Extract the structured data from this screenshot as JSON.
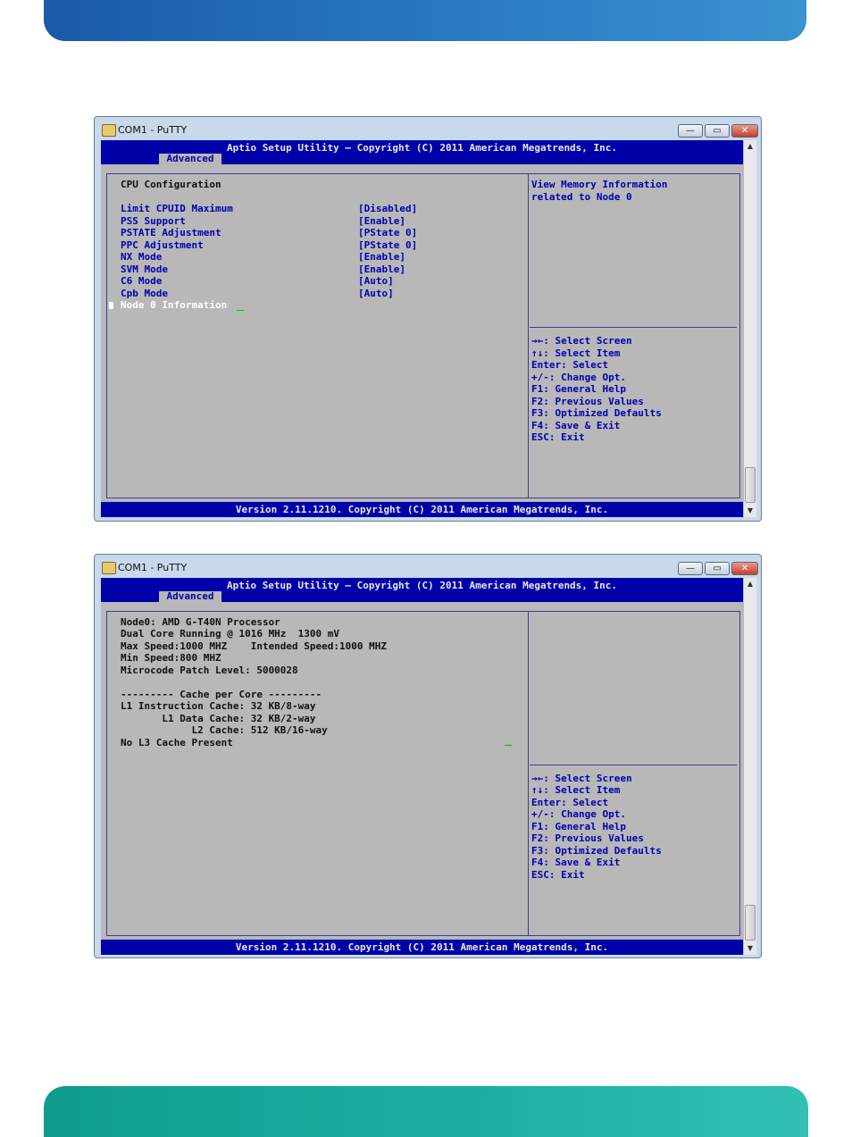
{
  "window1": {
    "title": "COM1 - PuTTY",
    "buttons": {
      "minimize": "—",
      "maximize": "▭",
      "close": "✕"
    },
    "header_title": "Aptio Setup Utility – Copyright (C) 2011 American Megatrends, Inc.",
    "active_tab": "Advanced",
    "section_title": "CPU Configuration",
    "settings": [
      {
        "label": "Limit CPUID Maximum",
        "value": "[Disabled]"
      },
      {
        "label": "PSS Support",
        "value": "[Enable]"
      },
      {
        "label": "PSTATE Adjustment",
        "value": "[PState 0]"
      },
      {
        "label": "PPC Adjustment",
        "value": "[PState 0]"
      },
      {
        "label": "NX Mode",
        "value": "[Enable]"
      },
      {
        "label": "SVM Mode",
        "value": "[Enable]"
      },
      {
        "label": "C6 Mode",
        "value": "[Auto]"
      },
      {
        "label": "Cpb Mode",
        "value": "[Auto]"
      }
    ],
    "submenu_item": "Node 0 Information",
    "help_text": [
      "View Memory Information",
      "related to Node 0"
    ],
    "keys": [
      "→←: Select Screen",
      "↑↓: Select Item",
      "Enter: Select",
      "+/-: Change Opt.",
      "F1: General Help",
      "F2: Previous Values",
      "F3: Optimized Defaults",
      "F4: Save & Exit",
      "ESC: Exit"
    ],
    "footer": "Version 2.11.1210. Copyright (C) 2011 American Megatrends, Inc."
  },
  "window2": {
    "title": "COM1 - PuTTY",
    "buttons": {
      "minimize": "—",
      "maximize": "▭",
      "close": "✕"
    },
    "header_title": "Aptio Setup Utility – Copyright (C) 2011 American Megatrends, Inc.",
    "active_tab": "Advanced",
    "info_lines": [
      "Node0: AMD G-T40N Processor",
      "Dual Core Running @ 1016 MHz  1300 mV",
      "Max Speed:1000 MHZ    Intended Speed:1000 MHZ",
      "Min Speed:800 MHZ",
      "Microcode Patch Level: 5000028",
      "",
      "--------- Cache per Core ---------",
      "L1 Instruction Cache: 32 KB/8-way",
      "       L1 Data Cache: 32 KB/2-way",
      "            L2 Cache: 512 KB/16-way",
      "No L3 Cache Present"
    ],
    "keys": [
      "→←: Select Screen",
      "↑↓: Select Item",
      "Enter: Select",
      "+/-: Change Opt.",
      "F1: General Help",
      "F2: Previous Values",
      "F3: Optimized Defaults",
      "F4: Save & Exit",
      "ESC: Exit"
    ],
    "footer": "Version 2.11.1210. Copyright (C) 2011 American Megatrends, Inc."
  },
  "colors": {
    "bios_blue": "#0000a8",
    "bios_gray": "#b8b8b8",
    "top_banner": "#2b7cc4",
    "bottom_banner": "#1fb0a3"
  }
}
